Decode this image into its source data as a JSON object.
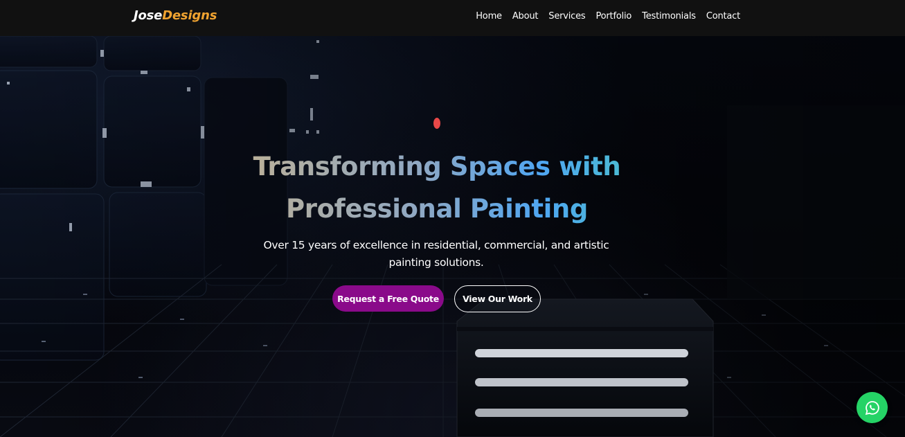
{
  "brand": {
    "part1": "Jose",
    "part2": "Designs",
    "color_part1": "#ffffff",
    "color_part2": "#f0a330"
  },
  "nav": {
    "items": [
      {
        "label": "Home"
      },
      {
        "label": "About"
      },
      {
        "label": "Services"
      },
      {
        "label": "Portfolio"
      },
      {
        "label": "Testimonials"
      },
      {
        "label": "Contact"
      }
    ]
  },
  "hero": {
    "title_line1": "Transforming Spaces with",
    "title_line2": "Professional Painting",
    "subtitle": "Over 15 years of excellence in residential, commercial, and artistic painting solutions.",
    "primary_cta": "Request a Free Quote",
    "secondary_cta": "View Our Work",
    "accent_color": "#8a0a8a",
    "title_gradient": [
      "#d9b07a",
      "#4fa6f2",
      "#45c6b8"
    ],
    "background_image": "dark-3d-grid-cubes"
  },
  "floating": {
    "whatsapp_icon": "whatsapp-icon",
    "whatsapp_color": "#25d366"
  }
}
